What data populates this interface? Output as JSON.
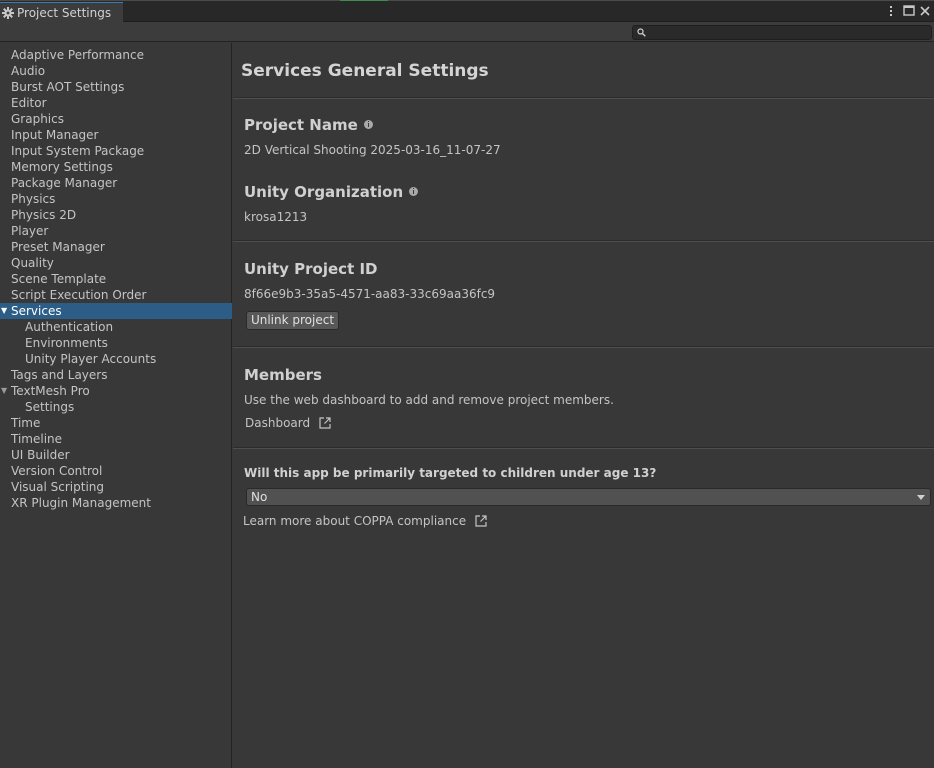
{
  "window": {
    "tab_title": "Project Settings",
    "tab_icon": "gear-icon",
    "controls": [
      "more-options-icon",
      "maximize-icon",
      "close-icon"
    ]
  },
  "search": {
    "placeholder": "",
    "icon": "search-icon"
  },
  "sidebar": {
    "items": [
      {
        "label": "Adaptive Performance"
      },
      {
        "label": "Audio"
      },
      {
        "label": "Burst AOT Settings"
      },
      {
        "label": "Editor"
      },
      {
        "label": "Graphics"
      },
      {
        "label": "Input Manager"
      },
      {
        "label": "Input System Package"
      },
      {
        "label": "Memory Settings"
      },
      {
        "label": "Package Manager"
      },
      {
        "label": "Physics"
      },
      {
        "label": "Physics 2D"
      },
      {
        "label": "Player"
      },
      {
        "label": "Preset Manager"
      },
      {
        "label": "Quality"
      },
      {
        "label": "Scene Template"
      },
      {
        "label": "Script Execution Order"
      },
      {
        "label": "Services",
        "selected": true,
        "expanded": true
      },
      {
        "label": "Authentication",
        "child": true
      },
      {
        "label": "Environments",
        "child": true
      },
      {
        "label": "Unity Player Accounts",
        "child": true
      },
      {
        "label": "Tags and Layers"
      },
      {
        "label": "TextMesh Pro",
        "expanded": true
      },
      {
        "label": "Settings",
        "child": true
      },
      {
        "label": "Time"
      },
      {
        "label": "Timeline"
      },
      {
        "label": "UI Builder"
      },
      {
        "label": "Version Control"
      },
      {
        "label": "Visual Scripting"
      },
      {
        "label": "XR Plugin Management"
      }
    ]
  },
  "main": {
    "title": "Services General Settings",
    "project_name": {
      "label": "Project Name",
      "value": "2D Vertical Shooting 2025-03-16_11-07-27"
    },
    "organization": {
      "label": "Unity Organization",
      "value": "krosa1213"
    },
    "project_id": {
      "label": "Unity Project ID",
      "value": "8f66e9b3-35a5-4571-aa83-33c69aa36fc9",
      "unlink_label": "Unlink project"
    },
    "members": {
      "label": "Members",
      "description": "Use the web dashboard to add and remove project members.",
      "dashboard_label": "Dashboard"
    },
    "coppa": {
      "question": "Will this app be primarily targeted to children under age 13?",
      "selected": "No",
      "learn_more": "Learn more about COPPA compliance"
    }
  },
  "colors": {
    "selection": "#2c5d87",
    "background": "#383838",
    "titlebar": "#282828"
  }
}
